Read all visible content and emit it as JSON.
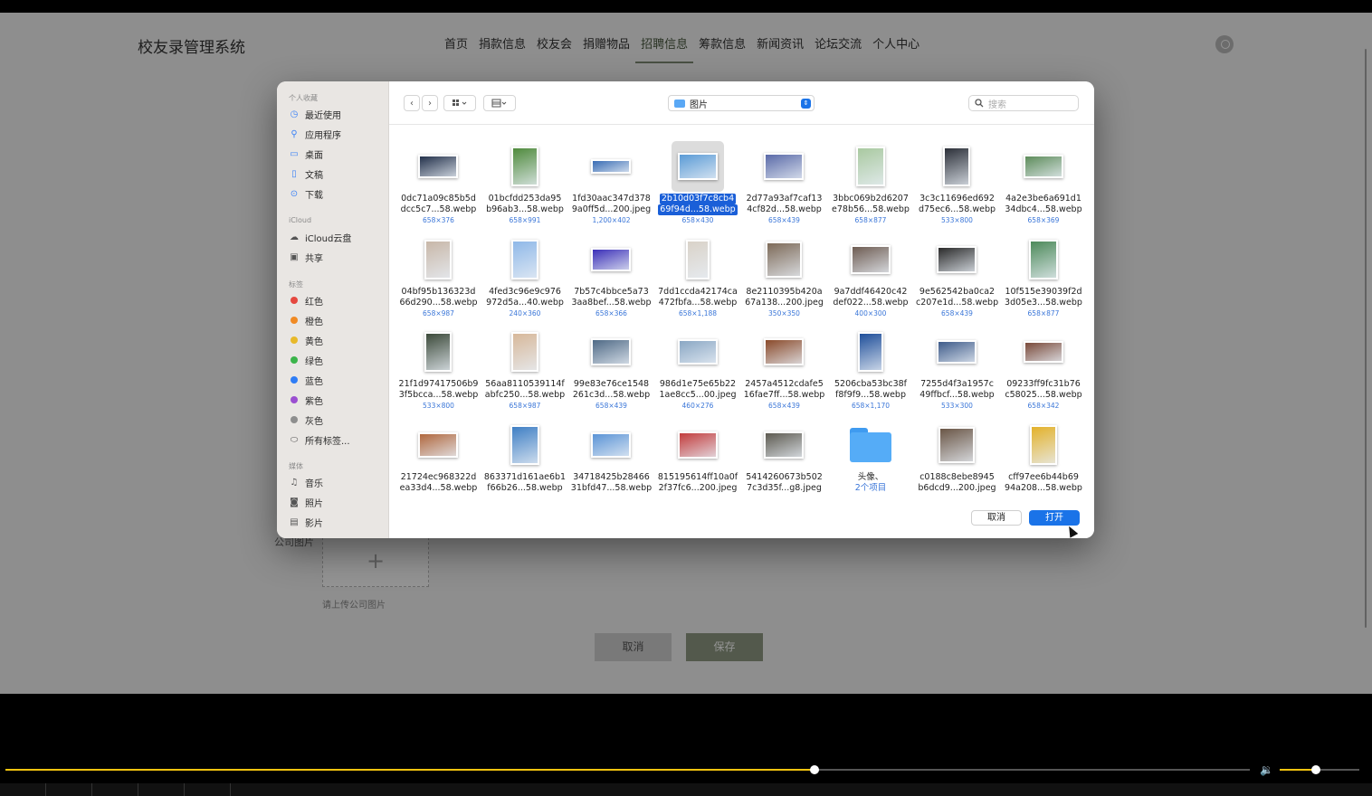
{
  "app": {
    "brand": "校友录管理系统",
    "nav": [
      "首页",
      "捐款信息",
      "校友会",
      "捐赠物品",
      "招聘信息",
      "筹款信息",
      "新闻资讯",
      "论坛交流",
      "个人中心"
    ],
    "active_nav": "招聘信息",
    "upload_label": "公司图片",
    "upload_plus": "+",
    "upload_hint": "请上传公司图片",
    "cancel_label": "取消",
    "save_label": "保存"
  },
  "dialog": {
    "sidebar": {
      "favorites_header": "个人收藏",
      "favorites": [
        {
          "label": "最近使用",
          "icon": "clock-icon"
        },
        {
          "label": "应用程序",
          "icon": "apps-icon"
        },
        {
          "label": "桌面",
          "icon": "desktop-icon"
        },
        {
          "label": "文稿",
          "icon": "document-icon"
        },
        {
          "label": "下载",
          "icon": "download-icon"
        }
      ],
      "icloud_header": "iCloud",
      "icloud": [
        {
          "label": "iCloud云盘",
          "icon": "cloud-icon"
        },
        {
          "label": "共享",
          "icon": "shared-folder-icon"
        }
      ],
      "tags_header": "标签",
      "tags": [
        {
          "label": "红色",
          "color": "#e5483f"
        },
        {
          "label": "橙色",
          "color": "#f08a24"
        },
        {
          "label": "黄色",
          "color": "#e8b92a"
        },
        {
          "label": "绿色",
          "color": "#3bb44a"
        },
        {
          "label": "蓝色",
          "color": "#2f7df6"
        },
        {
          "label": "紫色",
          "color": "#9b4fd1"
        },
        {
          "label": "灰色",
          "color": "#8e8e8e"
        }
      ],
      "all_tags": "所有标签...",
      "media_header": "媒体",
      "media": [
        {
          "label": "音乐",
          "icon": "music-icon"
        },
        {
          "label": "照片",
          "icon": "camera-icon"
        },
        {
          "label": "影片",
          "icon": "film-icon"
        }
      ]
    },
    "toolbar": {
      "back": "‹",
      "forward": "›",
      "view_icon": "grid-view-icon",
      "group_icon": "group-icon",
      "location": "图片",
      "search_placeholder": "搜索"
    },
    "files": [
      {
        "l1": "0dc71a09c85b5d",
        "l2": "dcc5c7...58.webp",
        "dim": "658×376",
        "color": "#22304a"
      },
      {
        "l1": "01bcfdd253da95",
        "l2": "b96ab3...58.webp",
        "dim": "658×991",
        "color": "#4f8a3c"
      },
      {
        "l1": "1fd30aac347d378",
        "l2": "9a0ff5d...200.jpeg",
        "dim": "1,200×402",
        "color": "#3a6db5"
      },
      {
        "l1": "2b10d03f7c8cb4",
        "l2": "69f94d...58.webp",
        "dim": "658×430",
        "color": "#5a9bd6",
        "selected": true
      },
      {
        "l1": "2d77a93af7caf13",
        "l2": "4cf82d...58.webp",
        "dim": "658×439",
        "color": "#5a6aa8"
      },
      {
        "l1": "3bbc069b2d6207",
        "l2": "e78b56...58.webp",
        "dim": "658×877",
        "color": "#a9c9a0"
      },
      {
        "l1": "3c3c11696ed692",
        "l2": "d75ec6...58.webp",
        "dim": "533×800",
        "color": "#2b2f38"
      },
      {
        "l1": "4a2e3be6a691d1",
        "l2": "34dbc4...58.webp",
        "dim": "658×369",
        "color": "#5d8c5a"
      },
      {
        "l1": "04bf95b136323d",
        "l2": "66d290...58.webp",
        "dim": "658×987",
        "color": "#c8b7a8"
      },
      {
        "l1": "4fed3c96e9c976",
        "l2": "972d5a...40.webp",
        "dim": "240×360",
        "color": "#8fb8e8"
      },
      {
        "l1": "7b57c4bbce5a73",
        "l2": "3aa8bef...58.webp",
        "dim": "658×366",
        "color": "#3b2fb8"
      },
      {
        "l1": "7dd1ccda42174ca",
        "l2": "472fbfa...58.webp",
        "dim": "658×1,188",
        "color": "#d9d2c8"
      },
      {
        "l1": "8e2110395b420a",
        "l2": "67a138...200.jpeg",
        "dim": "350×350",
        "color": "#7d6a58"
      },
      {
        "l1": "9a7ddf46420c42",
        "l2": "def022...58.webp",
        "dim": "400×300",
        "color": "#6e5c52"
      },
      {
        "l1": "9e562542ba0ca2",
        "l2": "c207e1d...58.webp",
        "dim": "658×439",
        "color": "#2a2a2a"
      },
      {
        "l1": "10f515e39039f2d",
        "l2": "3d05e3...58.webp",
        "dim": "658×877",
        "color": "#4d8a5a"
      },
      {
        "l1": "21f1d97417506b9",
        "l2": "3f5bcca...58.webp",
        "dim": "533×800",
        "color": "#3c4a3a"
      },
      {
        "l1": "56aa8110539114f",
        "l2": "abfc250...58.webp",
        "dim": "658×987",
        "color": "#d7b89a"
      },
      {
        "l1": "99e83e76ce1548",
        "l2": "261c3d...58.webp",
        "dim": "658×439",
        "color": "#4f6a86"
      },
      {
        "l1": "986d1e75e65b22",
        "l2": "1ae8cc5...00.jpeg",
        "dim": "460×276",
        "color": "#8aa7c4"
      },
      {
        "l1": "2457a4512cdafe5",
        "l2": "16fae7ff...58.webp",
        "dim": "658×439",
        "color": "#8a4a2a"
      },
      {
        "l1": "5206cba53bc38f",
        "l2": "f8f9f9...58.webp",
        "dim": "658×1,170",
        "color": "#1f4f9a"
      },
      {
        "l1": "7255d4f3a1957c",
        "l2": "49ffbcf...58.webp",
        "dim": "533×300",
        "color": "#3e5b8a"
      },
      {
        "l1": "09233ff9fc31b76",
        "l2": "c58025...58.webp",
        "dim": "658×342",
        "color": "#7a4a3a"
      },
      {
        "l1": "21724ec968322d",
        "l2": "ea33d4...58.webp",
        "dim": "",
        "color": "#b0683e"
      },
      {
        "l1": "863371d161ae6b1",
        "l2": "f66b26...58.webp",
        "dim": "",
        "color": "#3f7fc4"
      },
      {
        "l1": "34718425b28466",
        "l2": "31bfd47...58.webp",
        "dim": "",
        "color": "#5b94d6"
      },
      {
        "l1": "815195614ff10a0f",
        "l2": "2f37fc6...200.jpeg",
        "dim": "",
        "color": "#c23c3c"
      },
      {
        "l1": "5414260673b502",
        "l2": "7c3d35f...g8.jpeg",
        "dim": "",
        "color": "#5d5a50"
      },
      {
        "l1": "头像、",
        "l2": "2个项目",
        "dim": "",
        "folder": true
      },
      {
        "l1": "c0188c8ebe8945",
        "l2": "b6dcd9...200.jpeg",
        "dim": "",
        "color": "#6a5646"
      },
      {
        "l1": "cff97ee6b44b69",
        "l2": "94a208...58.webp",
        "dim": "",
        "color": "#e3b12a"
      }
    ],
    "cancel_label": "取消",
    "open_label": "打开"
  },
  "player": {
    "progress": 0.65,
    "volume": 0.45
  }
}
